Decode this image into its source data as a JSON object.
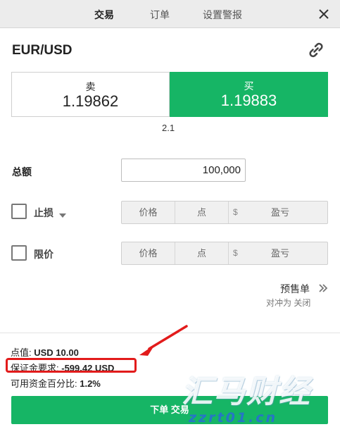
{
  "tabs": [
    {
      "label": "交易",
      "active": true
    },
    {
      "label": "订单",
      "active": false
    },
    {
      "label": "设置警报",
      "active": false
    }
  ],
  "icons": {
    "close": "close-icon",
    "link": "link-icon",
    "dropdown": "chevron-down-icon",
    "more": "double-chevron-right-icon"
  },
  "symbol": "EUR/USD",
  "sell": {
    "label": "卖",
    "price": "1.19862"
  },
  "buy": {
    "label": "买",
    "price": "1.19883"
  },
  "spread": "2.1",
  "amount": {
    "label": "总额",
    "value": "100,000"
  },
  "stop_loss": {
    "label": "止损",
    "price_ph": "价格",
    "pips_ph": "点",
    "currency": "$",
    "pl_ph": "盈亏"
  },
  "limit": {
    "label": "限价",
    "price_ph": "价格",
    "pips_ph": "点",
    "currency": "$",
    "pl_ph": "盈亏"
  },
  "presell": {
    "label": "预售单",
    "sub": "对冲为 关闭"
  },
  "info": {
    "pip_label": "点值: ",
    "pip_value": "USD 10.00",
    "margin_label": "保证金要求: ",
    "margin_value": "-599.42 USD",
    "percent_label": "可用资金百分比: ",
    "percent_value": "1.2%"
  },
  "submit": "下单 交易",
  "watermark": {
    "brand": "汇马财经",
    "url": "zzrt01.cn"
  },
  "colors": {
    "buy_green": "#16b565",
    "annotation_red": "#e21b1b",
    "watermark_blue": "#286ed2"
  }
}
